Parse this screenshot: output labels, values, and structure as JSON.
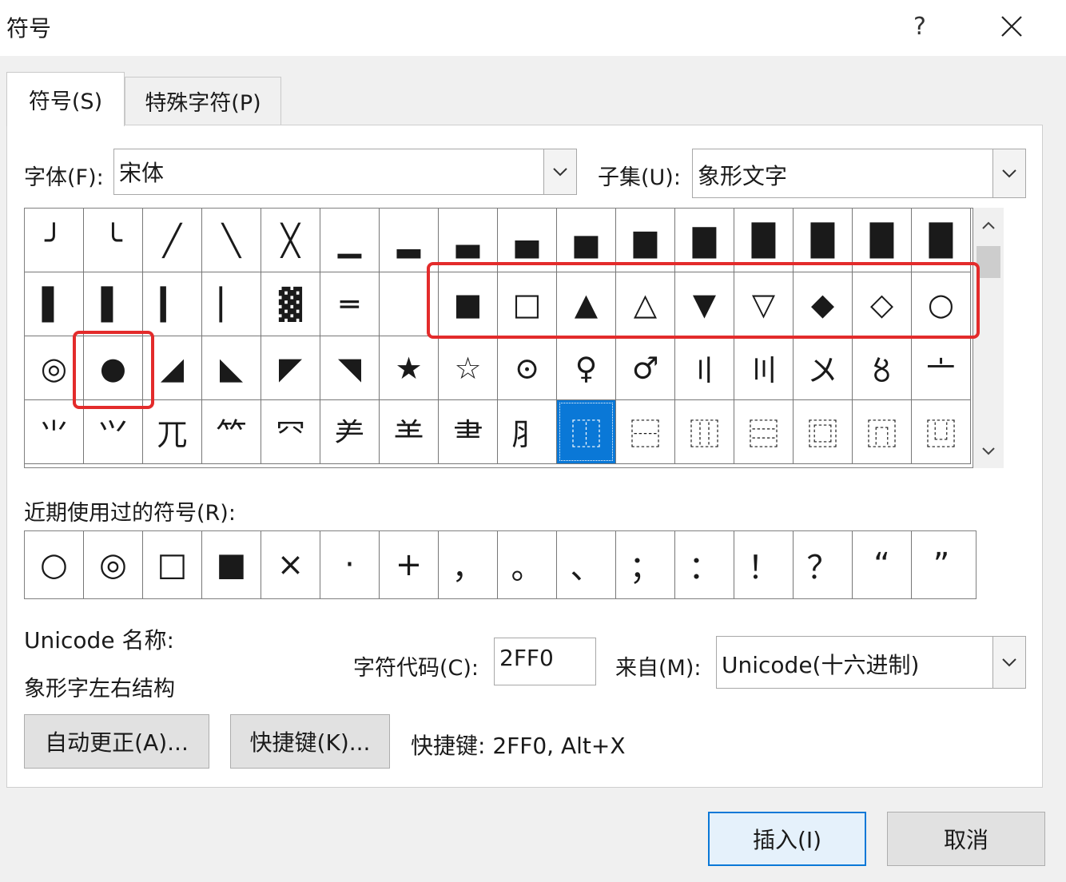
{
  "window": {
    "title": "符号",
    "help_label": "?"
  },
  "tabs": [
    {
      "label": "符号(S)",
      "active": true
    },
    {
      "label": "特殊字符(P)",
      "active": false
    }
  ],
  "font": {
    "label": "字体(F):",
    "value": "宋体"
  },
  "subset": {
    "label": "子集(U):",
    "value": "象形文字"
  },
  "symbol_grid": {
    "selected_index": 57,
    "cells": [
      "╯",
      "╰",
      "╱",
      "╲",
      "╳",
      "▁",
      "▂",
      "▃",
      "▄",
      "▅",
      "▆",
      "▇",
      "█",
      "█",
      "█",
      "█",
      "▌",
      "▌",
      "▎",
      "▏",
      "▓",
      "═",
      "",
      "■",
      "□",
      "▲",
      "△",
      "▼",
      "▽",
      "◆",
      "◇",
      "○",
      "◎",
      "●",
      "◢",
      "◣",
      "◤",
      "◥",
      "★",
      "☆",
      "⊙",
      "♀",
      "♂",
      "〢",
      "〣",
      "〤",
      "〥",
      "〦",
      "⺌",
      "⺍",
      "⺎",
      "⺮",
      "⺳",
      "⺶",
      "⺷",
      "⺻",
      "⺼",
      "⿰",
      "⿱",
      "⿲",
      "⿳",
      "⿴",
      "⿵",
      "⿶"
    ]
  },
  "recent": {
    "label": "近期使用过的符号(R):",
    "items": [
      "○",
      "◎",
      "□",
      "■",
      "×",
      "·",
      "+",
      "，",
      "。",
      "、",
      "；",
      "：",
      "！",
      "？",
      "“",
      "”"
    ]
  },
  "unicode_name": {
    "label": "Unicode 名称:",
    "value": "象形字左右结构"
  },
  "char_code": {
    "label": "字符代码(C):",
    "value": "2FF0"
  },
  "from": {
    "label": "来自(M):",
    "value": "Unicode(十六进制)"
  },
  "buttons": {
    "autocorrect": "自动更正(A)...",
    "shortcut_key": "快捷键(K)...",
    "insert": "插入(I)",
    "cancel": "取消"
  },
  "shortcut_text": "快捷键: 2FF0, Alt+X",
  "colors": {
    "selection": "#0a78d7",
    "highlight": "#e32b2b"
  }
}
